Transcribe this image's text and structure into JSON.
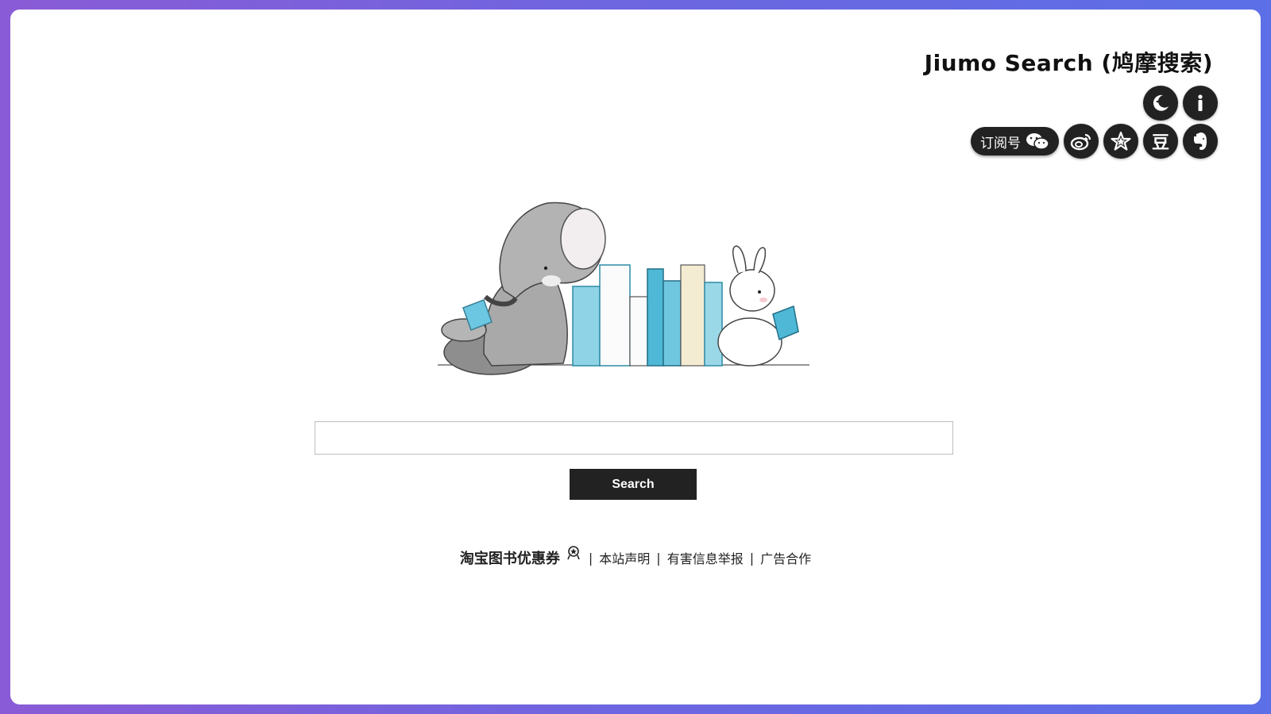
{
  "header": {
    "brand": "Jiumo Search (鸠摩搜索)",
    "top_icons": [
      {
        "name": "dark-mode-icon",
        "glyph": "moon"
      },
      {
        "name": "info-icon",
        "glyph": "i"
      }
    ],
    "subscribe_label": "订阅号",
    "social_icons": [
      {
        "name": "weibo-icon"
      },
      {
        "name": "star-icon"
      },
      {
        "name": "douban-icon",
        "glyph": "豆"
      },
      {
        "name": "evernote-icon"
      }
    ]
  },
  "search": {
    "placeholder": "",
    "value": "",
    "button_label": "Search"
  },
  "footer": {
    "promo": "淘宝图书优惠券",
    "links": [
      "本站声明",
      "有害信息举报",
      "广告合作"
    ],
    "separator": "|"
  },
  "colors": {
    "accent": "#222222",
    "background_gradient_start": "#8a5bd6",
    "background_gradient_end": "#5c6fe6",
    "book_blue": "#5bc3df"
  }
}
